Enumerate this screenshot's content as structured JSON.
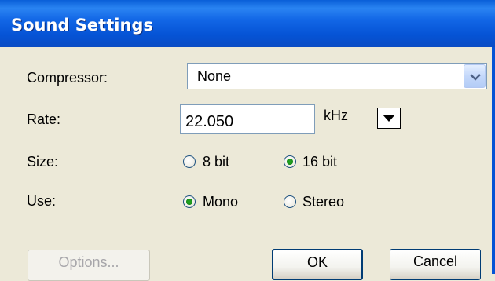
{
  "window": {
    "title": "Sound Settings"
  },
  "form": {
    "compressor": {
      "label": "Compressor:",
      "value": "None"
    },
    "rate": {
      "label": "Rate:",
      "value": "22.050",
      "unit": "kHz"
    },
    "size": {
      "label": "Size:",
      "options": [
        "8 bit",
        "16 bit"
      ],
      "selected": "16 bit"
    },
    "use": {
      "label": "Use:",
      "options": [
        "Mono",
        "Stereo"
      ],
      "selected": "Mono"
    }
  },
  "buttons": {
    "options": "Options...",
    "ok": "OK",
    "cancel": "Cancel"
  },
  "icons": {
    "select_arrow": "chevron-down-icon",
    "rate_dropdown": "triangle-down-icon"
  },
  "colors": {
    "titlebar": "#0553D5",
    "dialog_bg": "#ECE9D8",
    "radio_dot": "#21A121"
  }
}
